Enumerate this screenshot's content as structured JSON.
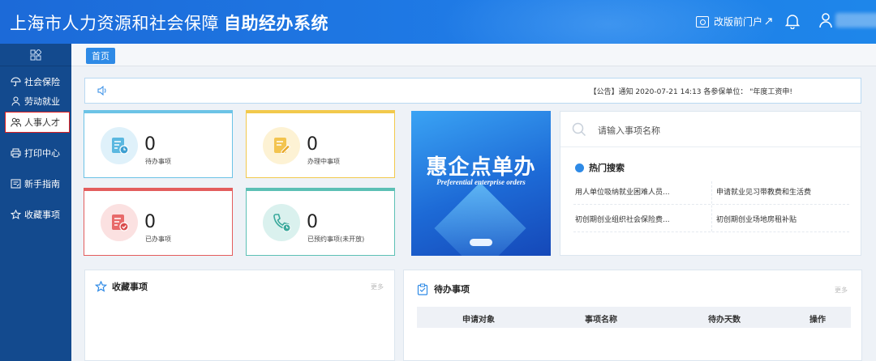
{
  "header": {
    "title_main": "上海市人力资源和社会保障",
    "title_sub": "自助经办系统",
    "portal_link": "改版前门户"
  },
  "sidebar": {
    "items": [
      {
        "label": "社会保险",
        "icon": "umbrella-icon"
      },
      {
        "label": "劳动就业",
        "icon": "person-icon"
      },
      {
        "label": "人事人才",
        "icon": "people-icon",
        "active": true
      },
      {
        "label": "打印中心",
        "icon": "printer-icon"
      },
      {
        "label": "新手指南",
        "icon": "guide-icon"
      },
      {
        "label": "收藏事项",
        "icon": "star-icon"
      }
    ]
  },
  "tabs": [
    {
      "label": "首页",
      "active": true
    }
  ],
  "notice": {
    "text": "【公告】通知 2020-07-21 14:13 各参保单位： \"年度工资申!"
  },
  "stats": [
    {
      "value": "0",
      "label": "待办事项",
      "color": "#6cc3e6"
    },
    {
      "value": "0",
      "label": "办理中事项",
      "color": "#f2c94c"
    },
    {
      "value": "0",
      "label": "已办事项",
      "color": "#e35d5d"
    },
    {
      "value": "0",
      "label": "已预约事项(未开放)",
      "color": "#5cc0b5"
    }
  ],
  "banner": {
    "title": "惠企点单办",
    "subtitle": "Preferential enterprise orders"
  },
  "search": {
    "placeholder": "请输入事项名称",
    "hot_title": "热门搜索",
    "hot_items": [
      "用人单位吸纳就业困难人员...",
      "申请就业见习带教费和生活费",
      "初创期创业组织社会保险费...",
      "初创期创业场地房租补贴"
    ]
  },
  "favorites": {
    "title": "收藏事项",
    "more": "更多"
  },
  "todo": {
    "title": "待办事项",
    "more": "更多",
    "columns": [
      "申请对象",
      "事项名称",
      "待办天数",
      "操作"
    ]
  },
  "colors": {
    "brand": "#1f7be6",
    "sidebar": "#134a8e",
    "accent": "#2e8ae6"
  }
}
